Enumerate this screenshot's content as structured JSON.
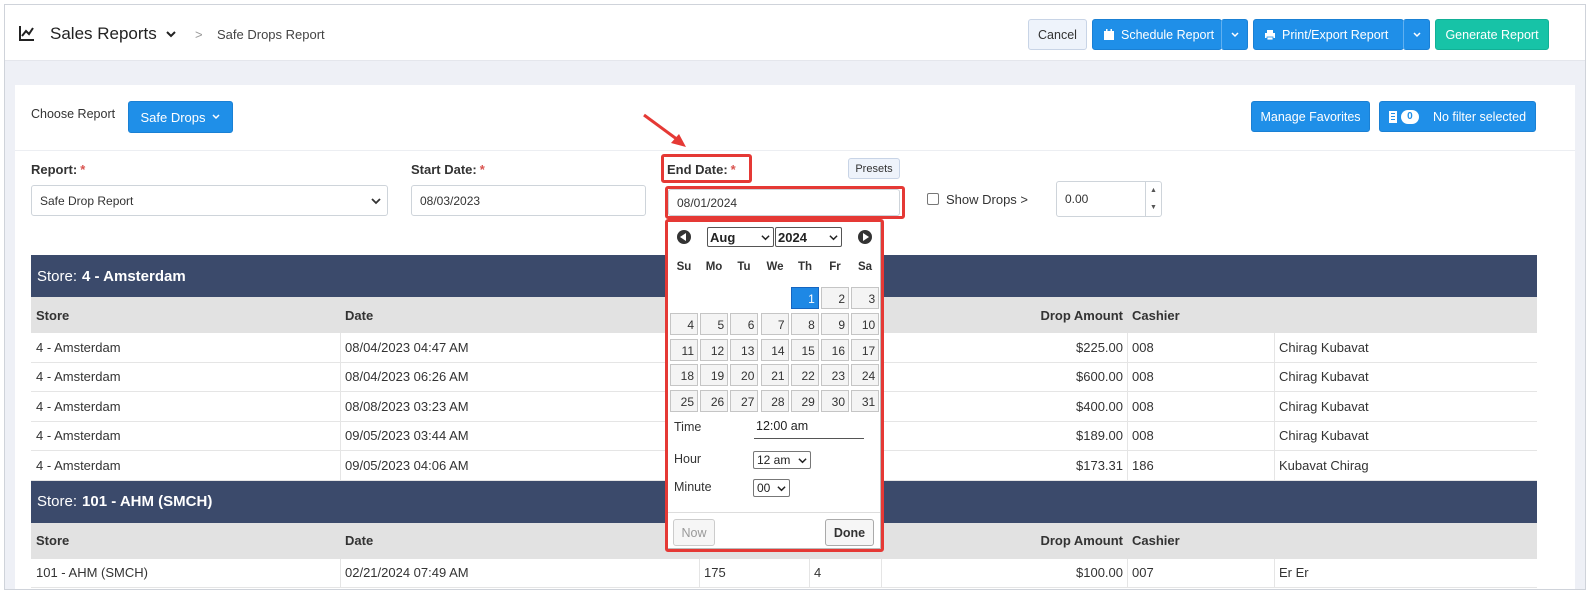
{
  "header": {
    "title": "Sales Reports",
    "breadcrumb_sep": ">",
    "breadcrumb": "Safe Drops Report",
    "cancel": "Cancel",
    "schedule": "Schedule Report",
    "print": "Print/Export Report",
    "generate": "Generate Report"
  },
  "toolbar": {
    "choose_label": "Choose Report",
    "report_button": "Safe Drops",
    "favorites": "Manage Favorites",
    "filter_count": "0",
    "filter_text": "No filter selected"
  },
  "form": {
    "report_label": "Report:",
    "report_value": "Safe Drop Report",
    "start_label": "Start Date:",
    "start_value": "08/03/2023",
    "end_label": "End Date:",
    "end_value": "08/01/2024",
    "presets": "Presets",
    "show_drops_label": "Show Drops >",
    "show_drops_value": "0.00",
    "required_mark": "*"
  },
  "table": {
    "groups": [
      {
        "store_prefix": "Store:",
        "store_name": "4 - Amsterdam",
        "columns": [
          "Store",
          "Date",
          "Drop Amount",
          "Cashier"
        ],
        "rows": [
          {
            "store": "4 - Amsterdam",
            "date": "08/04/2023 04:47 AM",
            "amount": "$225.00",
            "cashier_id": "008",
            "cashier": "Chirag Kubavat"
          },
          {
            "store": "4 - Amsterdam",
            "date": "08/04/2023 06:26 AM",
            "amount": "$600.00",
            "cashier_id": "008",
            "cashier": "Chirag Kubavat"
          },
          {
            "store": "4 - Amsterdam",
            "date": "08/08/2023 03:23 AM",
            "amount": "$400.00",
            "cashier_id": "008",
            "cashier": "Chirag Kubavat"
          },
          {
            "store": "4 - Amsterdam",
            "date": "09/05/2023 03:44 AM",
            "amount": "$189.00",
            "cashier_id": "008",
            "cashier": "Chirag Kubavat"
          },
          {
            "store": "4 - Amsterdam",
            "date": "09/05/2023 04:06 AM",
            "amount": "$173.31",
            "cashier_id": "186",
            "cashier": "Kubavat Chirag"
          }
        ]
      },
      {
        "store_prefix": "Store:",
        "store_name": "101 - AHM (SMCH)",
        "columns": [
          "Store",
          "Date",
          "Drop Amount",
          "Cashier"
        ],
        "rows": [
          {
            "store": "101 - AHM (SMCH)",
            "date": "02/21/2024 07:49 AM",
            "col3": "175",
            "col4": "4",
            "amount": "$100.00",
            "cashier_id": "007",
            "cashier": "Er Er"
          }
        ]
      }
    ]
  },
  "datepicker": {
    "month": "Aug",
    "year": "2024",
    "weekdays": [
      "Su",
      "Mo",
      "Tu",
      "We",
      "Th",
      "Fr",
      "Sa"
    ],
    "first_weekday_index": 4,
    "days_in_month": 31,
    "selected_day": 1,
    "time_label": "Time",
    "time_value": "12:00 am",
    "hour_label": "Hour",
    "hour_value": "12 am",
    "minute_label": "Minute",
    "minute_value": "00",
    "now": "Now",
    "done": "Done"
  },
  "colors": {
    "primary": "#1f8fe8",
    "generate": "#17c3a7",
    "store_header": "#3b4a6b",
    "highlight": "#e53935",
    "selected_day": "#1e88e5"
  }
}
